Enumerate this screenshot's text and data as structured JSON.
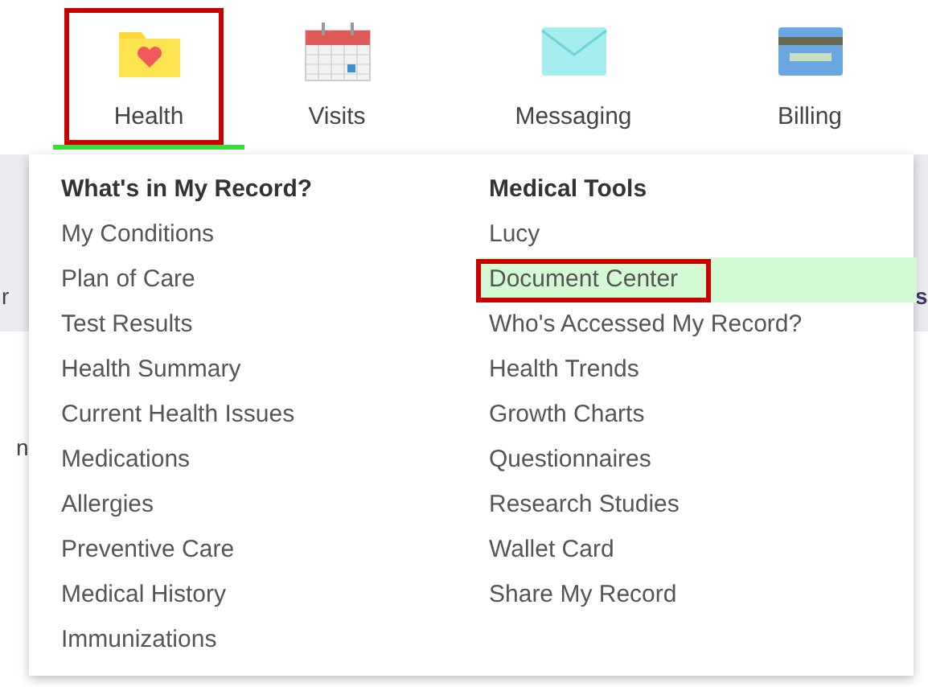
{
  "tabs": [
    {
      "label": "Health",
      "selected": true,
      "outlined": true
    },
    {
      "label": "Visits",
      "selected": false,
      "outlined": false
    },
    {
      "label": "Messaging",
      "selected": false,
      "outlined": false
    },
    {
      "label": "Billing",
      "selected": false,
      "outlined": false
    }
  ],
  "background_fragments": [
    "r",
    "n",
    "s"
  ],
  "menu": {
    "columns": [
      {
        "heading": "What's in My Record?",
        "items": [
          {
            "label": "My Conditions",
            "selected": false,
            "outlined": false
          },
          {
            "label": "Plan of Care",
            "selected": false,
            "outlined": false
          },
          {
            "label": "Test Results",
            "selected": false,
            "outlined": false
          },
          {
            "label": "Health Summary",
            "selected": false,
            "outlined": false
          },
          {
            "label": "Current Health Issues",
            "selected": false,
            "outlined": false
          },
          {
            "label": "Medications",
            "selected": false,
            "outlined": false
          },
          {
            "label": "Allergies",
            "selected": false,
            "outlined": false
          },
          {
            "label": "Preventive Care",
            "selected": false,
            "outlined": false
          },
          {
            "label": "Medical History",
            "selected": false,
            "outlined": false
          },
          {
            "label": "Immunizations",
            "selected": false,
            "outlined": false
          }
        ]
      },
      {
        "heading": "Medical Tools",
        "items": [
          {
            "label": "Lucy",
            "selected": false,
            "outlined": false
          },
          {
            "label": "Document Center",
            "selected": true,
            "outlined": true
          },
          {
            "label": "Who's Accessed My Record?",
            "selected": false,
            "outlined": false
          },
          {
            "label": "Health Trends",
            "selected": false,
            "outlined": false
          },
          {
            "label": "Growth Charts",
            "selected": false,
            "outlined": false
          },
          {
            "label": "Questionnaires",
            "selected": false,
            "outlined": false
          },
          {
            "label": "Research Studies",
            "selected": false,
            "outlined": false
          },
          {
            "label": "Wallet Card",
            "selected": false,
            "outlined": false
          },
          {
            "label": "Share My Record",
            "selected": false,
            "outlined": false
          }
        ]
      }
    ]
  }
}
